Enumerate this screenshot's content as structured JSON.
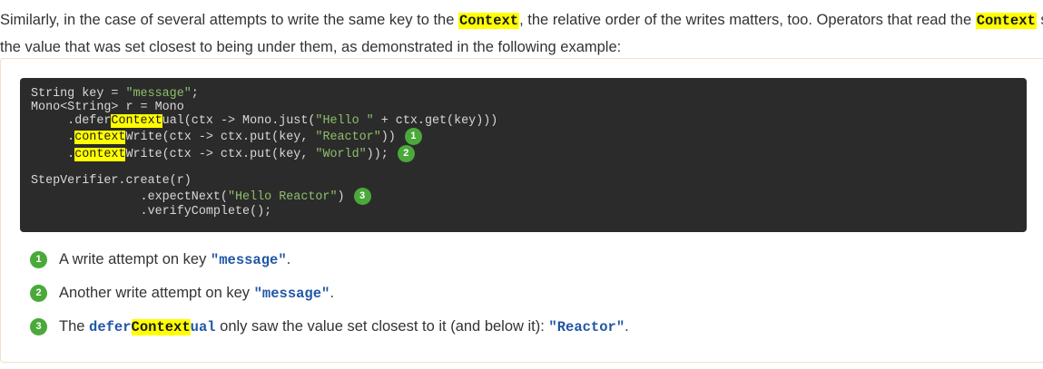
{
  "paragraph": {
    "line1_a": "Similarly, in the case of several attempts to write the same key to the ",
    "ctx1": "Context",
    "line1_b": ", the relative order of the writes matters, too. Operators that read the ",
    "ctx2": "Context",
    "line1_c": " see",
    "line2": "the value that was set closest to being under them, as demonstrated in the following example:"
  },
  "code": {
    "l1_a": "String key = ",
    "l1_str": "\"message\"",
    "l1_b": ";",
    "l2": "Mono<String> r = Mono",
    "l3_a": "     .defer",
    "l3_hl": "Context",
    "l3_b": "ual(ctx -> Mono.just(",
    "l3_str": "\"Hello \"",
    "l3_c": " + ctx.get(key)))",
    "l4_a": "     .",
    "l4_hl": "context",
    "l4_b": "Write(ctx -> ctx.put(key, ",
    "l4_str": "\"Reactor\"",
    "l4_c": "))",
    "l4_callout": "1",
    "l5_a": "     .",
    "l5_hl": "context",
    "l5_b": "Write(ctx -> ctx.put(key, ",
    "l5_str": "\"World\"",
    "l5_c": "));",
    "l5_callout": "2",
    "l6": "StepVerifier.create(r)",
    "l7_a": "               .expectNext(",
    "l7_str": "\"Hello Reactor\"",
    "l7_b": ")",
    "l7_callout": "3",
    "l8": "               .verifyComplete();"
  },
  "callouts": [
    {
      "num": "1",
      "text_a": "A write attempt on key ",
      "code": "\"message\"",
      "text_b": "."
    },
    {
      "num": "2",
      "text_a": "Another write attempt on key ",
      "code": "\"message\"",
      "text_b": "."
    },
    {
      "num": "3",
      "text_a": "The ",
      "code_a": "defer",
      "code_hl": "Context",
      "code_b": "ual",
      "text_b": " only saw the value set closest to it (and below it): ",
      "code": "\"Reactor\"",
      "text_c": "."
    }
  ]
}
